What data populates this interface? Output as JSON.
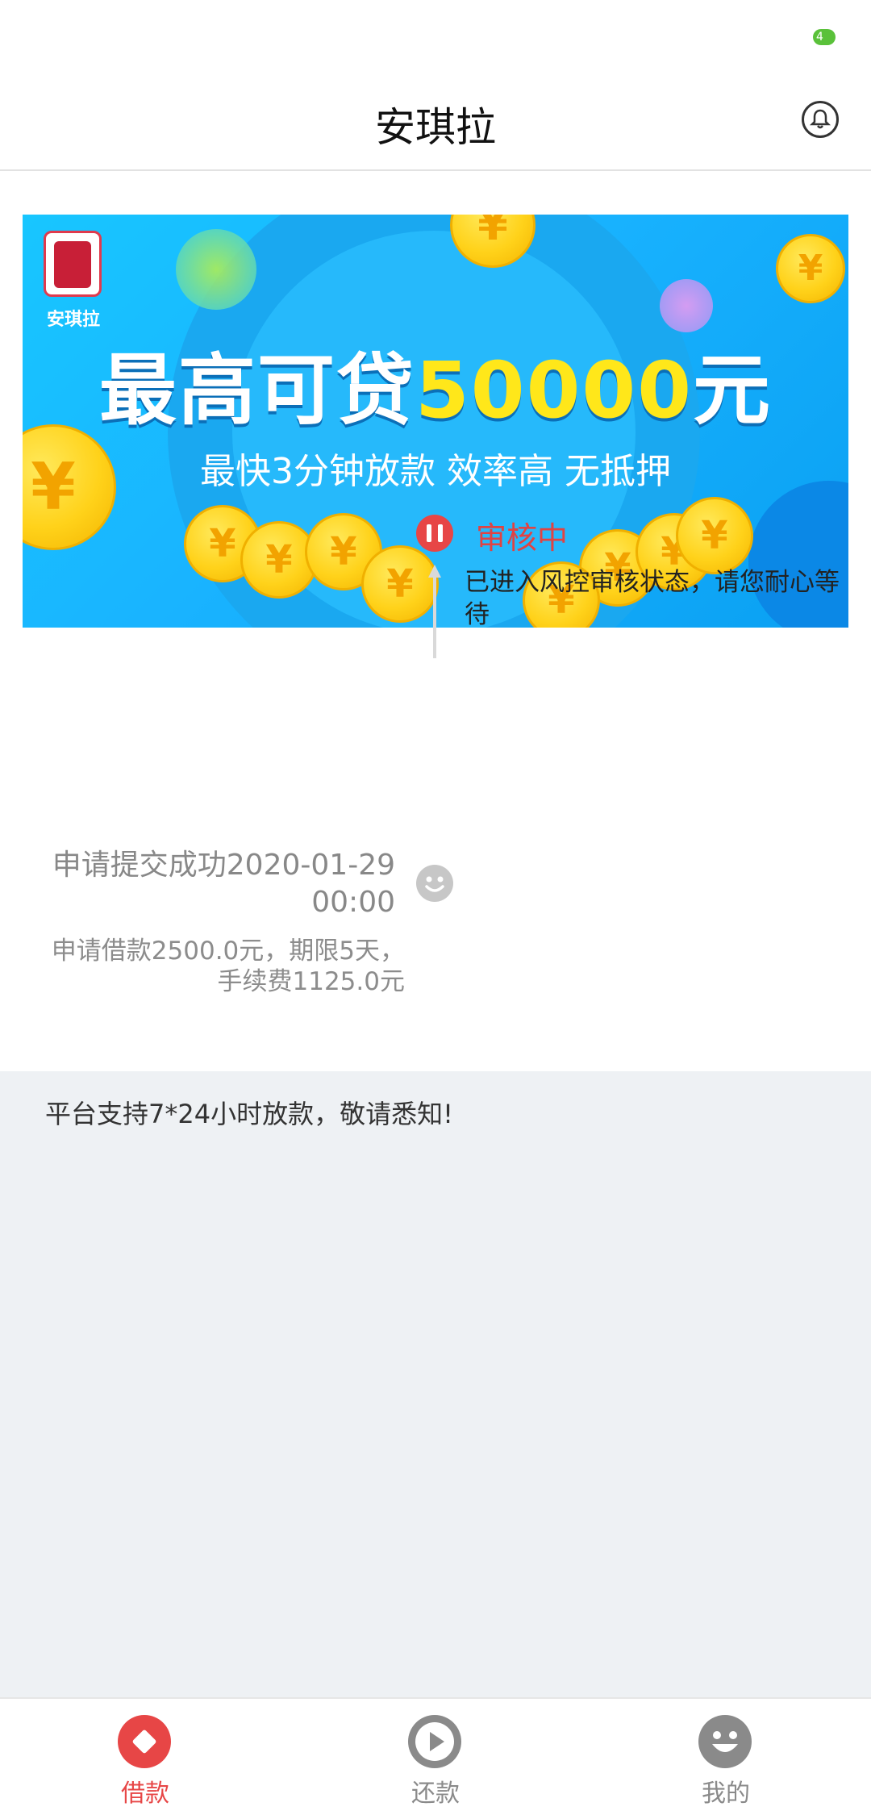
{
  "status_bar": {
    "battery": "4"
  },
  "header": {
    "title": "安琪拉"
  },
  "banner": {
    "brand": "安琪拉",
    "headline_prefix": "最高可贷",
    "headline_amount": "50000",
    "headline_suffix": "元",
    "subline": "最快3分钟放款 效率高 无抵押",
    "coin_symbol": "¥"
  },
  "timeline": {
    "current": {
      "title": "审核中",
      "desc": "已进入风控审核状态，请您耐心等待"
    },
    "applied": {
      "title": "申请提交成功2020-01-29",
      "time": "00:00",
      "desc_line1": "申请借款2500.0元，期限5天，",
      "desc_line2": "手续费1125.0元"
    }
  },
  "notice": "平台支持7*24小时放款，敬请悉知!",
  "tabbar": {
    "items": [
      {
        "label": "借款",
        "active": true
      },
      {
        "label": "还款",
        "active": false
      },
      {
        "label": "我的",
        "active": false
      }
    ]
  },
  "colors": {
    "accent": "#e74646",
    "inactive": "#8a8a8a",
    "background": "#eef1f4"
  }
}
